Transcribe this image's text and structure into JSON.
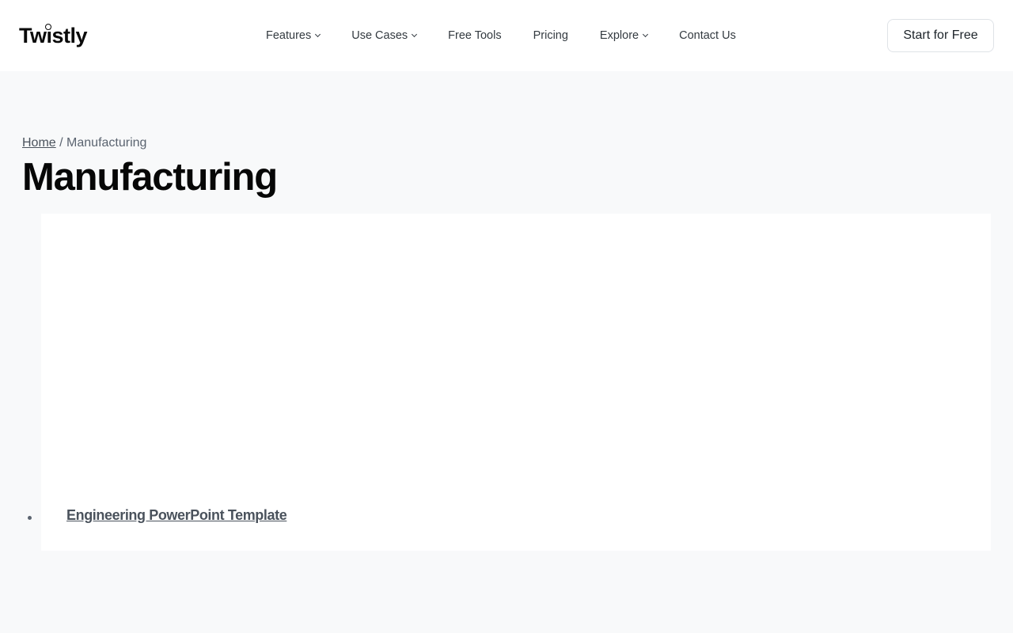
{
  "header": {
    "logo": "Twistly",
    "nav": [
      {
        "label": "Features"
      },
      {
        "label": "Use Cases"
      },
      {
        "label": "Free Tools"
      },
      {
        "label": "Pricing"
      },
      {
        "label": "Explore"
      },
      {
        "label": "Contact Us"
      }
    ],
    "cta_label": "Start for Free"
  },
  "breadcrumb": {
    "home": "Home",
    "separator": "/",
    "current": "Manufacturing"
  },
  "page": {
    "title": "Manufacturing"
  },
  "posts": [
    {
      "title": "Engineering PowerPoint Template"
    }
  ],
  "colors": {
    "page_background": "#f8f9fa",
    "header_background": "#ffffff",
    "link_text": "#4a525c"
  }
}
